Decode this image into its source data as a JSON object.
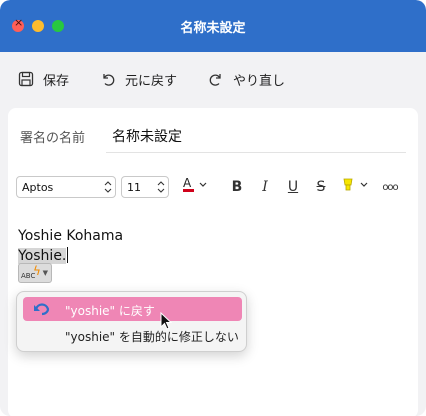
{
  "window": {
    "title": "名称未設定"
  },
  "toolbar": {
    "save_label": "保存",
    "undo_label": "元に戻す",
    "redo_label": "やり直し"
  },
  "signature": {
    "name_label": "署名の名前",
    "name_value": "名称未設定"
  },
  "format_bar": {
    "font_family": "Aptos",
    "font_size": "11",
    "font_color_icon": "font-color-icon",
    "font_color_swatch": "#d0021b",
    "bold_glyph": "B",
    "italic_glyph": "I",
    "underline_glyph": "U",
    "strike_glyph": "S",
    "highlight_color": "#f7e600",
    "more_glyph": "ooo"
  },
  "editor": {
    "line1": "Yoshie Kohama",
    "line2": "Yoshie."
  },
  "autocorrect": {
    "abc_text": "ABC",
    "bolt_glyph": "ϟ",
    "arrow_glyph": "▼"
  },
  "menu": {
    "revert_label": "\"yoshie\" に戻す",
    "stop_label": "\"yoshie\" を自動的に修正しない",
    "highlight_color": "#ef86b5"
  },
  "colors": {
    "titlebar": "#2f6fc9",
    "accent": "#ef86b5"
  }
}
